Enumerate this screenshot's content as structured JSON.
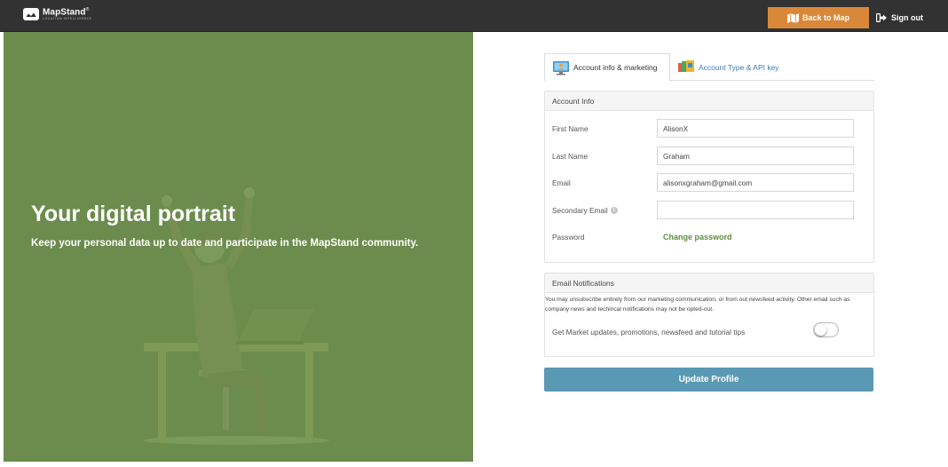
{
  "header": {
    "brand_name": "MapStand",
    "brand_tagline": "LOCATION INTELLIGENCE",
    "back_label": "Back to Map",
    "signout_label": "Sign out"
  },
  "hero": {
    "title": "Your digital portrait",
    "subtitle": "Keep your personal data up to date and participate in the MapStand community."
  },
  "tabs": [
    {
      "label": "Account info & marketing",
      "active": true,
      "icon": "monitor-user-icon"
    },
    {
      "label": "Account Type & API key",
      "active": false,
      "icon": "cards-icon"
    }
  ],
  "account": {
    "heading": "Account Info",
    "first_name_label": "First Name",
    "first_name_value": "AlisonX",
    "last_name_label": "Last Name",
    "last_name_value": "Graham",
    "email_label": "Email",
    "email_value": "alisonxgraham@gmail.com",
    "secondary_email_label": "Secondary Email",
    "secondary_email_value": "",
    "password_label": "Password",
    "change_password_label": "Change password"
  },
  "notifications": {
    "heading": "Email Notifications",
    "description": "You may unsubscribe entirely from our marketing communication, or from out newsfeed activity. Other email such as company news and techincal notifications may not be opted-out.",
    "option_label": "Get Market updates, promotions, newsfeed and tutorial tips",
    "option_enabled": false
  },
  "update_button_label": "Update Profile",
  "colors": {
    "topbar": "#323232",
    "accent_orange": "#d98839",
    "hero_green": "#6b8c4c",
    "update_blue": "#5a99b4",
    "link_green": "#5e8c3f",
    "tab_link_blue": "#3a7bbf"
  }
}
